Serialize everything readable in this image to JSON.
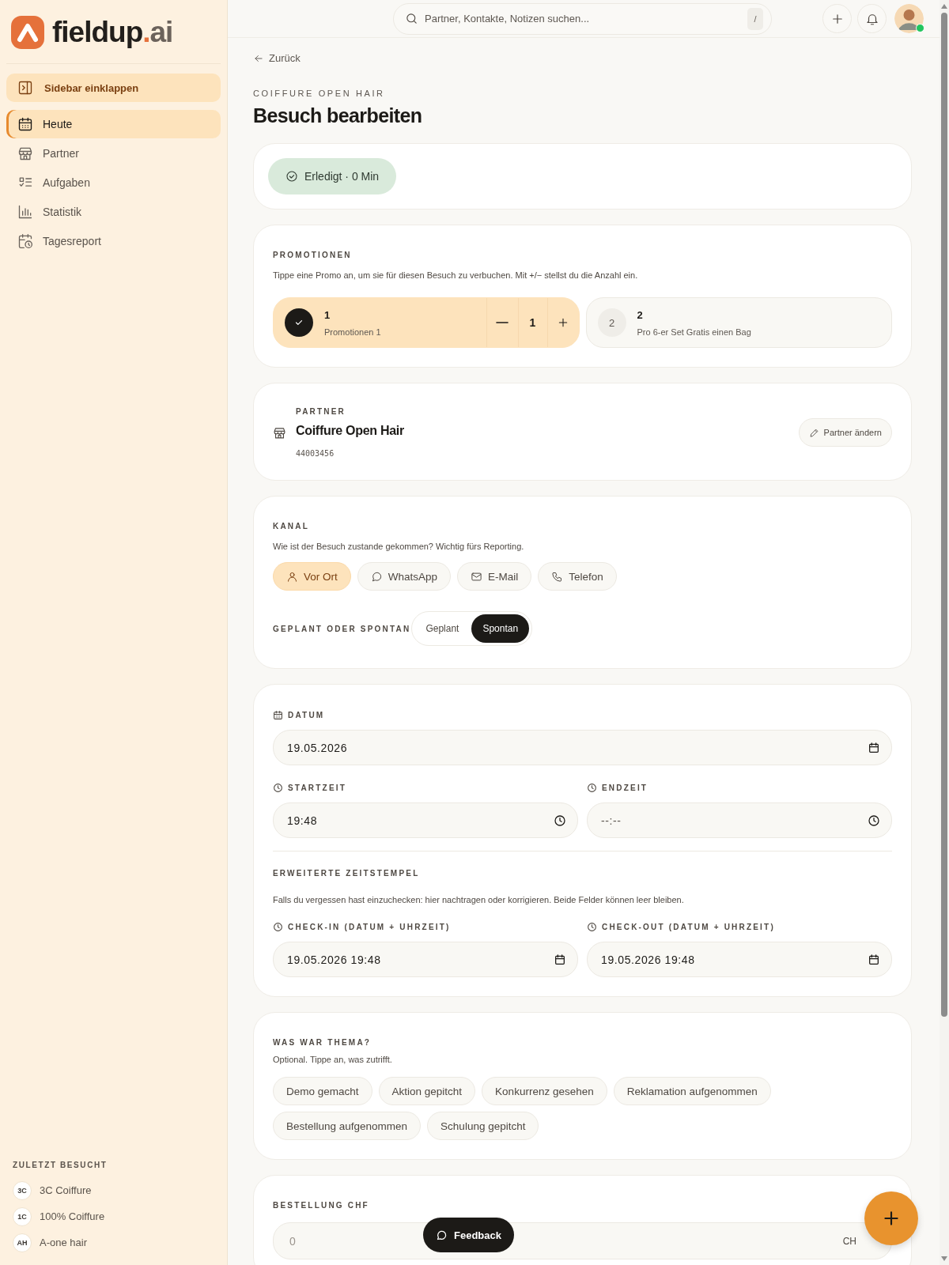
{
  "sidebar": {
    "logo": {
      "name": "fieldup",
      "suffix": ".ai"
    },
    "collapse_button": "Sidebar einklappen",
    "nav": [
      {
        "label": "Heute",
        "selected": true
      },
      {
        "label": "Partner",
        "selected": false
      },
      {
        "label": "Aufgaben",
        "selected": false
      },
      {
        "label": "Statistik",
        "selected": false
      },
      {
        "label": "Tagesreport",
        "selected": false
      }
    ],
    "recent": {
      "title": "ZULETZT BESUCHT",
      "items": [
        {
          "initials": "3C",
          "name": "3C Coiffure"
        },
        {
          "initials": "1C",
          "name": "100% Coiffure"
        },
        {
          "initials": "AH",
          "name": "A-one hair"
        }
      ]
    }
  },
  "topbar": {
    "search": {
      "placeholder": "Partner, Kontakte, Notizen suchen...",
      "shortcut": "/"
    },
    "user_online": true
  },
  "back_link": "Zurück",
  "eyebrow": "COIFFURE OPEN HAIR",
  "title": "Besuch bearbeiten",
  "status": {
    "label": "Erledigt · 0 Min"
  },
  "promotions": {
    "title": "PROMOTIONEN",
    "hint": "Tippe eine Promo an, um sie für diesen Besuch zu verbuchen. Mit +/− stellst du die Anzahl ein.",
    "items": [
      {
        "number": "1",
        "name": "Promotionen 1",
        "selected": true,
        "count": "1"
      },
      {
        "number": "2",
        "name": "Pro 6-er Set Gratis einen Bag",
        "selected": false,
        "badge": "2"
      }
    ]
  },
  "partner": {
    "label": "PARTNER",
    "name": "Coiffure Open Hair",
    "id": "44003456",
    "change_button": "Partner ändern"
  },
  "channel": {
    "label": "KANAL",
    "hint": "Wie ist der Besuch zustande gekommen? Wichtig fürs Reporting.",
    "options": [
      {
        "label": "Vor Ort",
        "selected": true
      },
      {
        "label": "WhatsApp",
        "selected": false
      },
      {
        "label": "E-Mail",
        "selected": false
      },
      {
        "label": "Telefon",
        "selected": false
      }
    ],
    "planned_label": "GEPLANT ODER SPONTAN",
    "planned_options": [
      {
        "label": "Geplant",
        "selected": false
      },
      {
        "label": "Spontan",
        "selected": true
      }
    ]
  },
  "time": {
    "date": {
      "kind": "date",
      "label": "DATUM",
      "value": "19.05.2026"
    },
    "start": {
      "kind": "time",
      "label": "STARTZEIT",
      "value": "19:48"
    },
    "end": {
      "kind": "time",
      "label": "ENDZEIT",
      "placeholder": "--:--"
    },
    "extended": {
      "title": "ERWEITERTE ZEITSTEMPEL",
      "hint": "Falls du vergessen hast einzuchecken: hier nachtragen oder korrigieren. Beide Felder können leer bleiben.",
      "check_in": {
        "kind": "datetime",
        "label": "CHECK-IN (DATUM + UHRZEIT)",
        "value": "19.05.2026 19:48"
      },
      "check_out": {
        "kind": "datetime",
        "label": "CHECK-OUT (DATUM + UHRZEIT)",
        "value": "19.05.2026 19:48"
      }
    }
  },
  "topics": {
    "title": "WAS WAR THEMA?",
    "hint": "Optional. Tippe an, was zutrifft.",
    "items": [
      {
        "label": "Demo gemacht",
        "selected": false
      },
      {
        "label": "Aktion gepitcht",
        "selected": false
      },
      {
        "label": "Konkurrenz gesehen",
        "selected": false
      },
      {
        "label": "Reklamation aufgenommen",
        "selected": false
      },
      {
        "label": "Bestellung aufgenommen",
        "selected": false
      },
      {
        "label": "Schulung gepitcht",
        "selected": false
      }
    ]
  },
  "order": {
    "label": "BESTELLUNG CHF",
    "placeholder": "0",
    "suffix": "CH"
  },
  "feedback_button": "Feedback"
}
